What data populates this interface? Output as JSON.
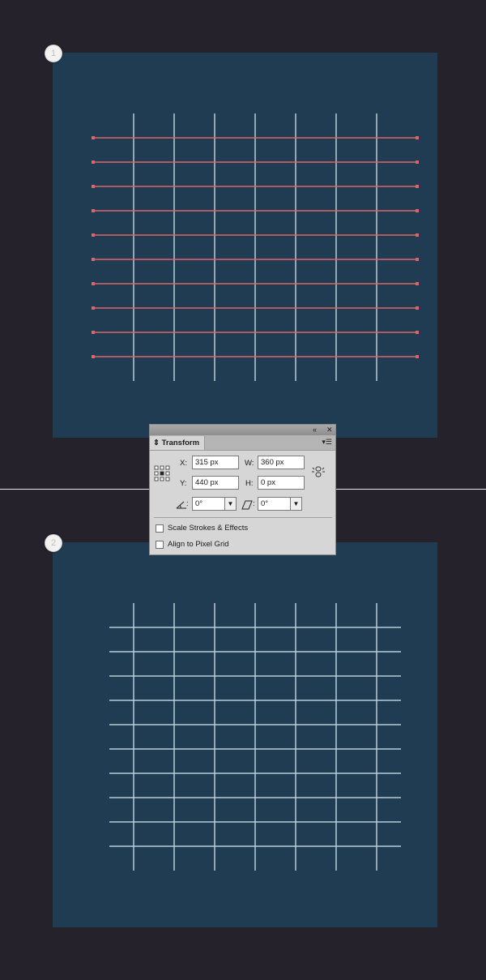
{
  "steps": {
    "step1": "1",
    "step2": "2"
  },
  "colors": {
    "background": "#26222b",
    "artboard": "#1f3c53",
    "vertical_lines": "#b9cbd6",
    "selected_lines": "#e06464",
    "selection_anchor": "#e06464"
  },
  "transform_panel": {
    "collapse_icon": "double-chevron-left-icon",
    "close_icon": "close-icon",
    "tab_label": "Transform",
    "menu_icon": "panel-menu-icon",
    "reference_point_icon": "reference-point-locator-icon",
    "x_label": "X:",
    "x_value": "315 px",
    "y_label": "Y:",
    "y_value": "440 px",
    "w_label": "W:",
    "w_value": "360 px",
    "h_label": "H:",
    "h_value": "0 px",
    "constrain_icon": "link-proportions-icon",
    "rotate_value": "0°",
    "shear_value": "0°",
    "scale_strokes_label": "Scale Strokes & Effects",
    "scale_strokes_checked": false,
    "align_pixel_label": "Align to Pixel Grid",
    "align_pixel_checked": false
  },
  "grid": {
    "vertical_line_count": 7,
    "horizontal_line_count": 10,
    "top_horizontal_lines_selected": true,
    "bottom_horizontal_lines_selected": false
  }
}
